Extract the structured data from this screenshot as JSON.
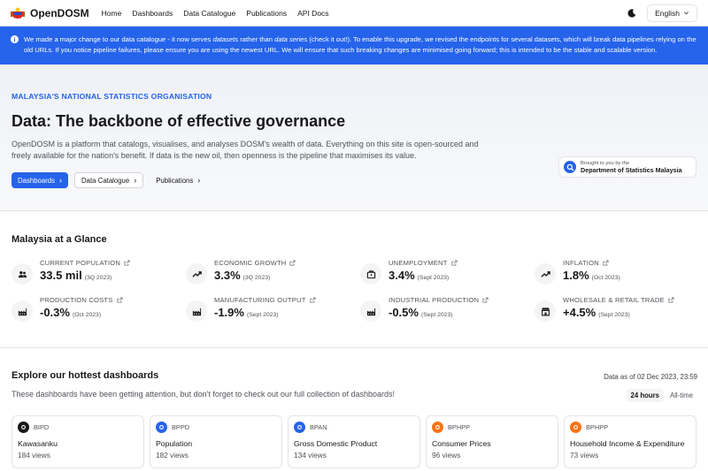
{
  "nav": {
    "brand": "OpenDOSM",
    "links": [
      "Home",
      "Dashboards",
      "Data Catalogue",
      "Publications",
      "API Docs"
    ],
    "language": "English"
  },
  "banner": {
    "part1": "We made a major change to our data catalogue - it now serves ",
    "em1": "datasets",
    "part2": " rather than ",
    "em2": "data series",
    "part3": " (check it out!). To enable this upgrade, we revised the endpoints for several datasets, which will break data pipelines relying on the old URLs. If you notice pipeline failures, please ensure you are using the newest URL. We will ensure that such breaking changes are minimised going forward; this is intended to be the stable and scalable version."
  },
  "hero": {
    "eyebrow": "MALAYSIA'S NATIONAL STATISTICS ORGANISATION",
    "title": "Data: The backbone of effective governance",
    "description": "OpenDOSM is a platform that catalogs, visualises, and analyses DOSM's wealth of data. Everything on this site is open-sourced and freely available for the nation's benefit. If data is the new oil, then openness is the pipeline that maximises its value.",
    "buttons": {
      "dashboards": "Dashboards",
      "catalogue": "Data Catalogue",
      "publications": "Publications"
    },
    "brought_by": "Brought to you by the",
    "agency": "Department of Statistics Malaysia"
  },
  "glance": {
    "title": "Malaysia at a Glance",
    "stats": [
      {
        "label": "CURRENT POPULATION",
        "value": "33.5 mil",
        "period": "(3Q 2023)",
        "icon": "people-icon"
      },
      {
        "label": "ECONOMIC GROWTH",
        "value": "3.3%",
        "period": "(3Q 2023)",
        "icon": "trend-up-icon"
      },
      {
        "label": "UNEMPLOYMENT",
        "value": "3.4%",
        "period": "(Sept 2023)",
        "icon": "briefcase-icon"
      },
      {
        "label": "INFLATION",
        "value": "1.8%",
        "period": "(Oct 2023)",
        "icon": "trend-up-icon"
      },
      {
        "label": "PRODUCTION COSTS",
        "value": "-0.3%",
        "period": "(Oct 2023)",
        "icon": "factory-icon"
      },
      {
        "label": "MANUFACTURING OUTPUT",
        "value": "-1.9%",
        "period": "(Sept 2023)",
        "icon": "factory-icon"
      },
      {
        "label": "INDUSTRIAL PRODUCTION",
        "value": "-0.5%",
        "period": "(Sept 2023)",
        "icon": "factory-icon"
      },
      {
        "label": "WHOLESALE & RETAIL TRADE",
        "value": "+4.5%",
        "period": "(Sept 2023)",
        "icon": "store-icon"
      }
    ]
  },
  "explore": {
    "title": "Explore our hottest dashboards",
    "description": "These dashboards have been getting attention, but don't forget to check out our full collection of dashboards!",
    "as_of": "Data as of 02 Dec 2023, 23:59",
    "toggle": [
      "24 hours",
      "All-time"
    ],
    "cards": [
      {
        "code": "BIPD",
        "title": "Kawasanku",
        "views": "184 views",
        "color": "#18181b"
      },
      {
        "code": "BPPD",
        "title": "Population",
        "views": "182 views",
        "color": "#2563eb"
      },
      {
        "code": "BPAN",
        "title": "Gross Domestic Product",
        "views": "134 views",
        "color": "#2563eb"
      },
      {
        "code": "BPHPP",
        "title": "Consumer Prices",
        "views": "96 views",
        "color": "#f97316"
      },
      {
        "code": "BPHPP",
        "title": "Household Income & Expenditure",
        "views": "73 views",
        "color": "#f97316"
      }
    ]
  }
}
